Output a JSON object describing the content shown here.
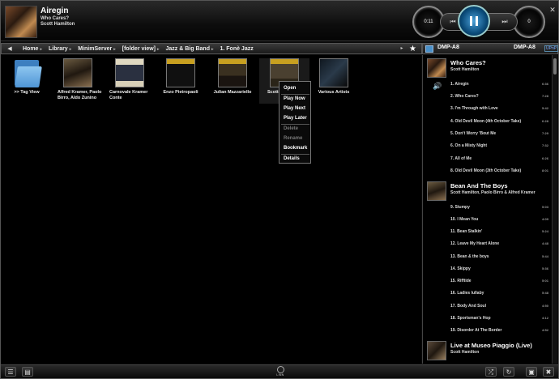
{
  "now_playing": {
    "title": "Airegin",
    "album": "Who Cares?",
    "artist": "Scott Hamilton",
    "elapsed": "0:11",
    "remaining": "0"
  },
  "breadcrumb": [
    "Home",
    "Library",
    "MinimServer",
    "[folder view]",
    "Jazz & Big Band",
    "1. Fonè Jazz"
  ],
  "rooms": {
    "room": "DMP-A8",
    "source": "DMP-A8",
    "badge": "UPnP"
  },
  "browse_tiles": [
    {
      "label": ">> Tag View",
      "type": "folder"
    },
    {
      "label": "Alfred Kramer, Paolo Birro, Aldo Zunino",
      "type": "album"
    },
    {
      "label": "Carnovale Kramer Conte",
      "type": "album"
    },
    {
      "label": "Enzo Pietropaoli",
      "type": "album"
    },
    {
      "label": "Julian Mazzariello",
      "type": "album"
    },
    {
      "label": "Scott",
      "type": "album"
    },
    {
      "label": "Various Artists",
      "type": "album"
    }
  ],
  "context_menu": [
    {
      "label": "Open",
      "enabled": true
    },
    {
      "label": "Play Now",
      "enabled": true
    },
    {
      "label": "Play Next",
      "enabled": true
    },
    {
      "label": "Play Later",
      "enabled": true
    },
    {
      "label": "Delete",
      "enabled": false
    },
    {
      "label": "Rename",
      "enabled": false
    },
    {
      "label": "Bookmark",
      "enabled": true
    },
    {
      "label": "Details",
      "enabled": true
    }
  ],
  "playlist": [
    {
      "album": "Who Cares?",
      "artist": "Scott Hamilton",
      "tracks": [
        {
          "name": "1. Airegin",
          "dur": "6:36"
        },
        {
          "name": "2. Who Cares?",
          "dur": "7:28"
        },
        {
          "name": "3. I'm Through with Love",
          "dur": "5:42"
        },
        {
          "name": "4. Old Devil Moon (4th October Take)",
          "dur": "6:28"
        },
        {
          "name": "5. Don't Worry 'Bout Me",
          "dur": "7:29"
        },
        {
          "name": "6. On a Misty Night",
          "dur": "7:32"
        },
        {
          "name": "7. All of Me",
          "dur": "6:26"
        },
        {
          "name": "8. Old Devil Moon (3th October Take)",
          "dur": "8:01"
        }
      ]
    },
    {
      "album": "Bean And The Boys",
      "artist": "Scott Hamilton, Paolo Birro & Alfred Kramer",
      "tracks": [
        {
          "name": "9. Stumpy",
          "dur": "5:03"
        },
        {
          "name": "10. I Mean You",
          "dur": "4:09"
        },
        {
          "name": "11. Bean Stalkin'",
          "dur": "5:24"
        },
        {
          "name": "12. Leave My Heart Alone",
          "dur": "4:48"
        },
        {
          "name": "13. Bean & the boys",
          "dur": "5:44"
        },
        {
          "name": "14. Skippy",
          "dur": "5:36"
        },
        {
          "name": "15. Rifftide",
          "dur": "5:01"
        },
        {
          "name": "16. Ladies lullaby",
          "dur": "5:48"
        },
        {
          "name": "17. Body And Soul",
          "dur": "4:50"
        },
        {
          "name": "18. Sportsman's Hop",
          "dur": "4:12"
        },
        {
          "name": "19. Disorder At The Border",
          "dur": "4:52"
        }
      ]
    },
    {
      "album": "Live at Museo Piaggio (Live)",
      "artist": "Scott Hamilton",
      "tracks": []
    }
  ],
  "logo_text": "LINN"
}
